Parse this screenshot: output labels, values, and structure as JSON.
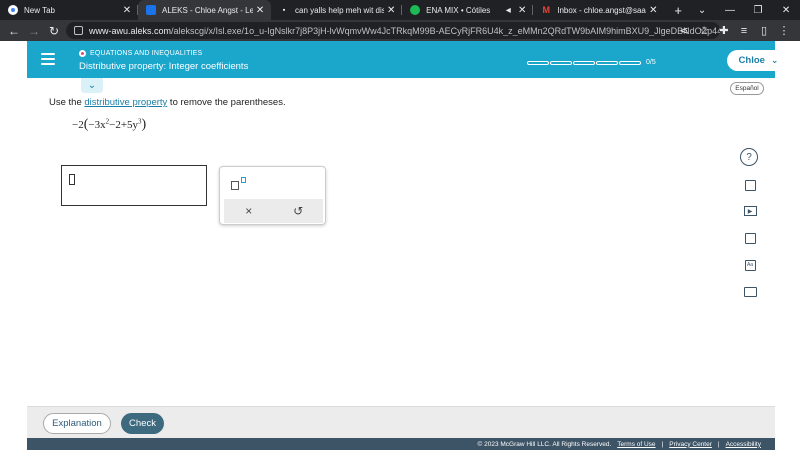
{
  "browser": {
    "tabs": [
      {
        "title": "New Tab",
        "favicon": "chrome-icon",
        "color": "#ffffff",
        "active": false
      },
      {
        "title": "ALEKS - Chloe Angst - Learn",
        "favicon": "aleks-icon",
        "color": "#1a73e8",
        "active": true
      },
      {
        "title": "can yalls help meh wit dis pls!",
        "favicon": "brainly-icon",
        "color": "#ffffff",
        "active": false
      },
      {
        "title": "ENA MIX • Cótiles",
        "favicon": "spotify-icon",
        "color": "#1db954",
        "active": false
      },
      {
        "title": "Inbox - chloe.angst@saadragon",
        "favicon": "gmail-icon",
        "color": "#ea4335",
        "active": false
      }
    ],
    "new_tab": "+",
    "url_host": "www-awu.aleks.com",
    "url_path": "/alekscgi/x/Isl.exe/1o_u-IgNslkr7j8P3jH-lvWqmvWw4JcTRkqM99B-AECyRjFR6U4k_z_eMMn2QRdTW9bAIM9himBXU9_JlgeDBNdOZp44vMn..."
  },
  "header": {
    "topic": "EQUATIONS AND INEQUALITIES",
    "title": "Distributive property: Integer coefficients",
    "progress_text": "0/5",
    "progress_segments": 5,
    "progress_filled": 0,
    "user_name": "Chloe",
    "accent": "#1ba6cc"
  },
  "language_button": "Español",
  "problem": {
    "instruction_prefix": "Use the ",
    "instruction_link": "distributive property",
    "instruction_suffix": " to remove the parentheses.",
    "expr_lead": "−2",
    "expr_open": "(",
    "expr_a": "−3x",
    "expr_a_exp": "2",
    "expr_mid": "−2+5y",
    "expr_b_exp": "3",
    "expr_close": ")"
  },
  "keypad": {
    "clear": "×",
    "undo": "↺"
  },
  "side_tools": {
    "help": "?"
  },
  "footer": {
    "explanation": "Explanation",
    "check": "Check",
    "copyright": "© 2023 McGraw Hill LLC. All Rights Reserved.",
    "terms": "Terms of Use",
    "privacy": "Privacy Center",
    "accessibility": "Accessibility",
    "sep": "|"
  }
}
